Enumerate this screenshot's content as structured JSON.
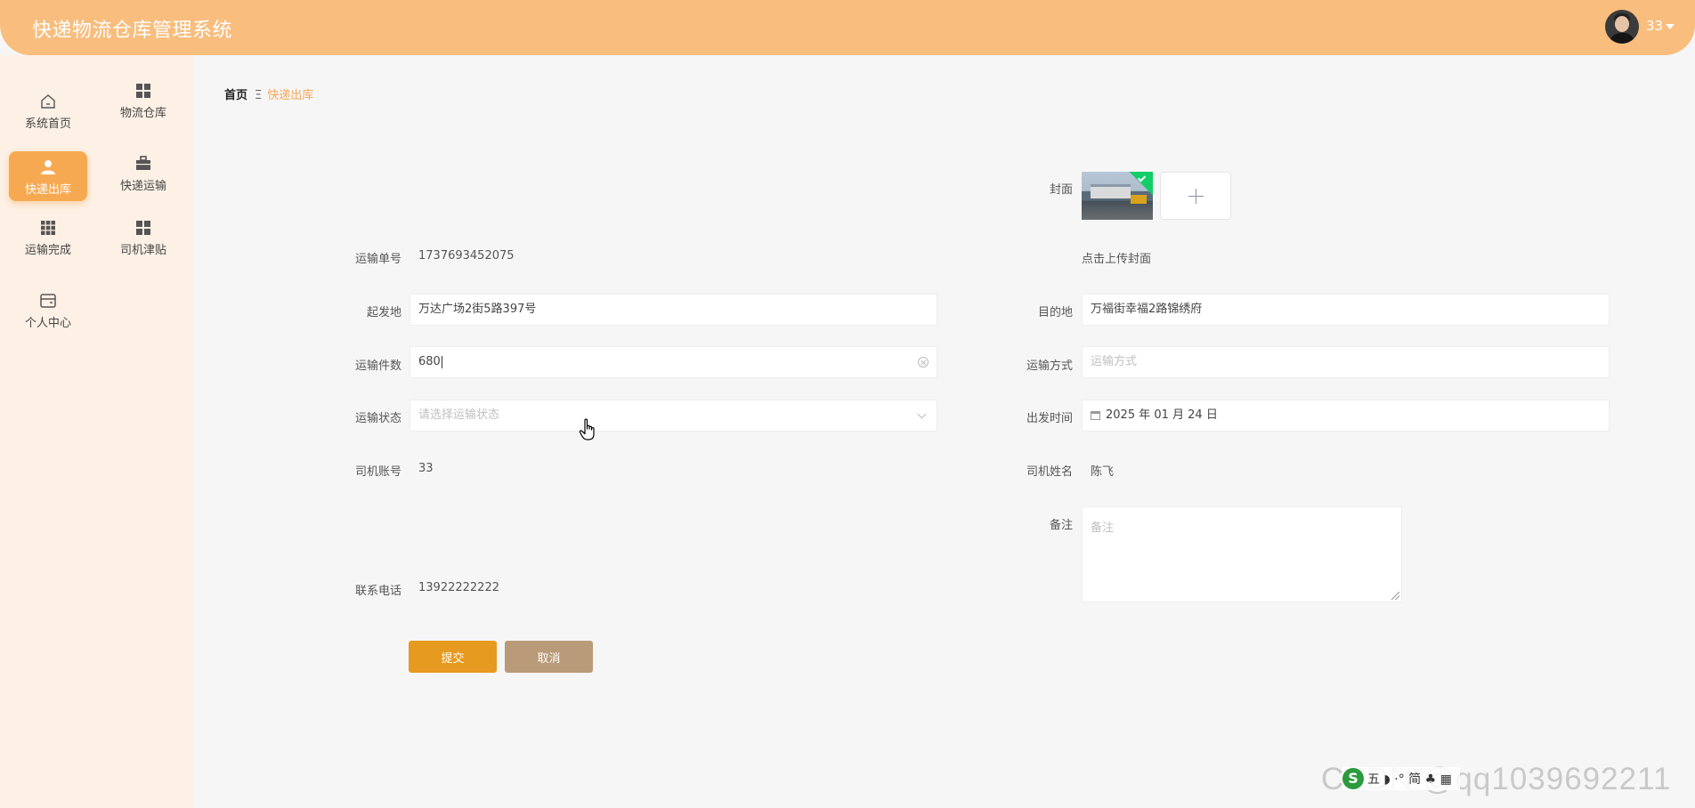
{
  "header": {
    "app_title": "快递物流仓库管理系统",
    "username": "33"
  },
  "sidebar": {
    "items": [
      {
        "label": "系统首页",
        "icon": "home-icon"
      },
      {
        "label": "物流仓库",
        "icon": "grid-icon"
      },
      {
        "label": "快递出库",
        "icon": "user-icon",
        "active": true
      },
      {
        "label": "快递运输",
        "icon": "briefcase-icon"
      },
      {
        "label": "运输完成",
        "icon": "grid9-icon"
      },
      {
        "label": "司机津贴",
        "icon": "grid-icon"
      },
      {
        "label": "个人中心",
        "icon": "wallet-icon"
      }
    ]
  },
  "breadcrumb": {
    "home": "首页",
    "separator": "Ξ",
    "current": "快递出库"
  },
  "form": {
    "cover_label": "封面",
    "cover_hint": "点击上传封面",
    "order_no_label": "运输单号",
    "order_no": "1737693452075",
    "origin_label": "起发地",
    "origin": "万达广场2街5路397号",
    "destination_label": "目的地",
    "destination": "万福街幸福2路锦绣府",
    "quantity_label": "运输件数",
    "quantity": "680",
    "method_label": "运输方式",
    "method_placeholder": "运输方式",
    "status_label": "运输状态",
    "status_placeholder": "请选择运输状态",
    "depart_label": "出发时间",
    "depart_time": "2025 年 01 月 24 日",
    "driver_account_label": "司机账号",
    "driver_account": "33",
    "driver_name_label": "司机姓名",
    "driver_name": "陈飞",
    "remark_label": "备注",
    "remark_placeholder": "备注",
    "phone_label": "联系电话",
    "phone": "13922222222",
    "submit_label": "提交",
    "cancel_label": "取消"
  },
  "watermark": {
    "text": "CSDN @qq1039692211",
    "ime_logo": "S",
    "ime_text": "五 ◗ ·° 简 ♣ ▦"
  },
  "colors": {
    "header": "#f9bd7d",
    "sidebar": "#fdf1e6",
    "active_nav": "#f7a952",
    "breadcrumb_current": "#f3a85a",
    "submit": "#e69a1f",
    "cancel": "#b99a79"
  }
}
